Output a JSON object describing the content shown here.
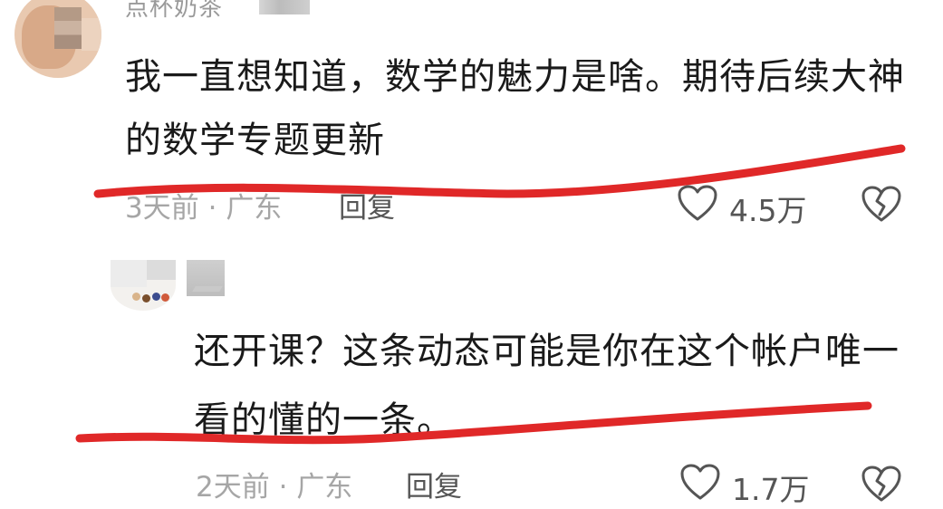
{
  "comment1": {
    "username": "点杯奶茶",
    "text": "我一直想知道，数学的魅力是啥。期待后续大神的数学专题更新",
    "time": "3天前",
    "separator": "·",
    "location": "广东",
    "reply_label": "回复",
    "like_count": "4.5万"
  },
  "comment2": {
    "text": "还开课？这条动态可能是你在这个帐户唯一看的懂的一条。",
    "time": "2天前",
    "separator": "·",
    "location": "广东",
    "reply_label": "回复",
    "like_count": "1.7万"
  },
  "colors": {
    "underline": "#e02828",
    "text": "#1a1a1a",
    "meta": "#a6a6a6",
    "icon": "#555555"
  },
  "icons": {
    "like": "heart-outline-icon",
    "dislike": "broken-heart-icon"
  }
}
